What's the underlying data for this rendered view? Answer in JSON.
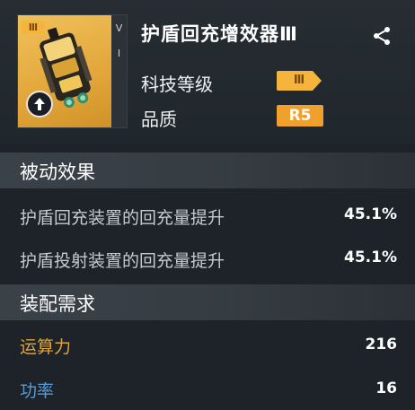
{
  "item": {
    "name": "护盾回充增效器Ⅲ",
    "tier_badge": "Ⅲ",
    "side_mark_top": "V",
    "side_mark_bottom": "I",
    "icons": {
      "upgrade": "arrow-up-circle-icon",
      "share": "share-icon"
    }
  },
  "meta": {
    "tech_level_label": "科技等级",
    "tech_level_value": "Ⅲ",
    "quality_label": "品质",
    "quality_value": "R5"
  },
  "passive": {
    "title": "被动效果",
    "rows": [
      {
        "label": "护盾回充装置的回充量提升",
        "value": "45.1%"
      },
      {
        "label": "护盾投射装置的回充量提升",
        "value": "45.1%"
      }
    ]
  },
  "requirements": {
    "title": "装配需求",
    "rows": [
      {
        "label": "运算力",
        "value": "216",
        "color": "#e0a43a"
      },
      {
        "label": "功率",
        "value": "16",
        "color": "#5b9bd5"
      }
    ]
  },
  "colors": {
    "accent_gold": "#f0a02c",
    "background": "#1d2328"
  }
}
